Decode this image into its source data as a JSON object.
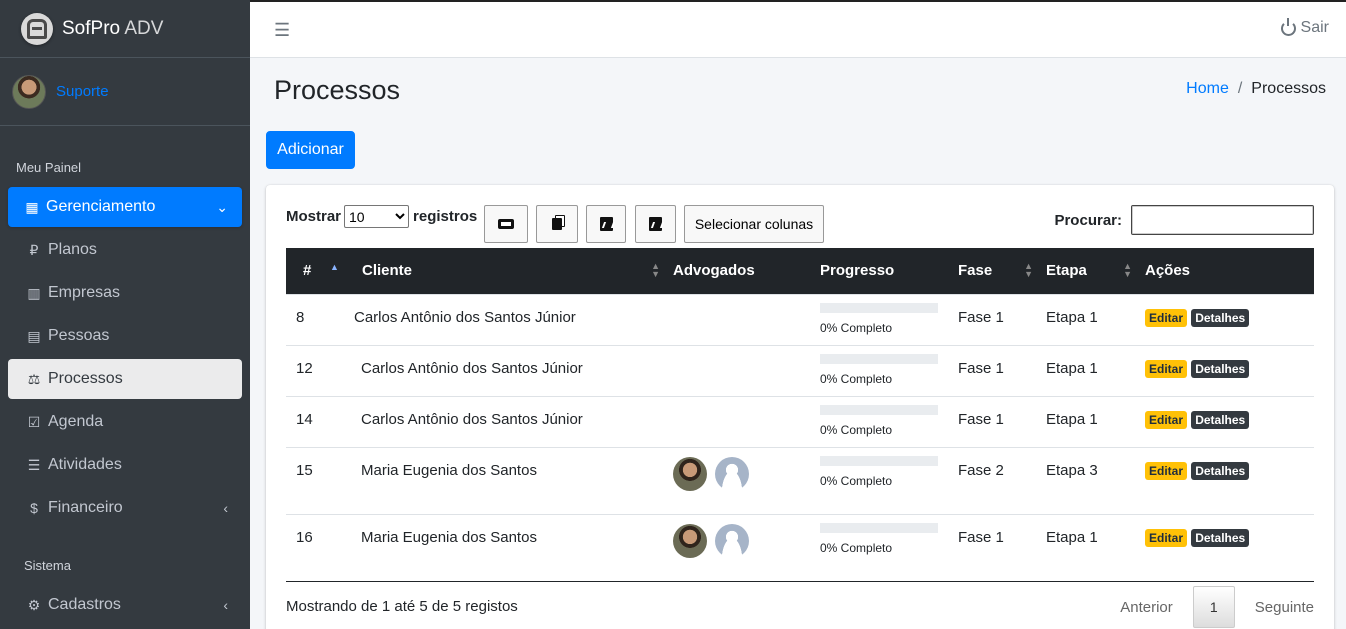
{
  "brand": {
    "name": "SofPro",
    "suffix": " ADV"
  },
  "user": {
    "name": "Suporte"
  },
  "nav": {
    "header_main": "Meu Painel",
    "header_system": "Sistema",
    "items": [
      {
        "label": "Gerenciamento",
        "icon": "dashboard-icon"
      },
      {
        "label": "Planos",
        "icon": "paypal-icon"
      },
      {
        "label": "Empresas",
        "icon": "building-icon"
      },
      {
        "label": "Pessoas",
        "icon": "id-card-icon"
      },
      {
        "label": "Processos",
        "icon": "balance-scale-icon"
      },
      {
        "label": "Agenda",
        "icon": "calendar-check-icon"
      },
      {
        "label": "Atividades",
        "icon": "tasks-icon"
      },
      {
        "label": "Financeiro",
        "icon": "money-icon"
      },
      {
        "label": "Cadastros",
        "icon": "cogs-icon"
      }
    ]
  },
  "topbar": {
    "logout_label": "Sair"
  },
  "page": {
    "title": "Processos",
    "breadcrumb_home": "Home",
    "breadcrumb_sep": "/",
    "breadcrumb_current": "Processos",
    "add_button": "Adicionar"
  },
  "table_controls": {
    "show_label": "Mostrar",
    "length_value": "10",
    "records_label": "registros",
    "columns_button": "Selecionar colunas",
    "search_label": "Procurar:"
  },
  "table": {
    "headers": [
      "#",
      "Cliente",
      "Advogados",
      "Progresso",
      "Fase",
      "Etapa",
      "Ações"
    ],
    "rows": [
      {
        "id": "8",
        "cliente": "Carlos Antônio dos Santos Júnior",
        "progress": "0% Completo",
        "fase": "Fase 1",
        "etapa": "Etapa 1"
      },
      {
        "id": "12",
        "cliente": "Carlos Antônio dos Santos Júnior",
        "progress": "0% Completo",
        "fase": "Fase 1",
        "etapa": "Etapa 1"
      },
      {
        "id": "14",
        "cliente": "Carlos Antônio dos Santos Júnior",
        "progress": "0% Completo",
        "fase": "Fase 1",
        "etapa": "Etapa 1"
      },
      {
        "id": "15",
        "cliente": "Maria Eugenia dos Santos",
        "progress": "0% Completo",
        "fase": "Fase 2",
        "etapa": "Etapa 3"
      },
      {
        "id": "16",
        "cliente": "Maria Eugenia dos Santos",
        "progress": "0% Completo",
        "fase": "Fase 1",
        "etapa": "Etapa 1"
      }
    ],
    "edit_label": "Editar",
    "details_label": "Detalhes"
  },
  "footer": {
    "info": "Mostrando de 1 até 5 de 5 registos",
    "prev": "Anterior",
    "page": "1",
    "next": "Seguinte"
  },
  "colors": {
    "primary": "#007bff",
    "sidebar": "#343a40",
    "warning": "#ffc107",
    "dark": "#212529"
  }
}
